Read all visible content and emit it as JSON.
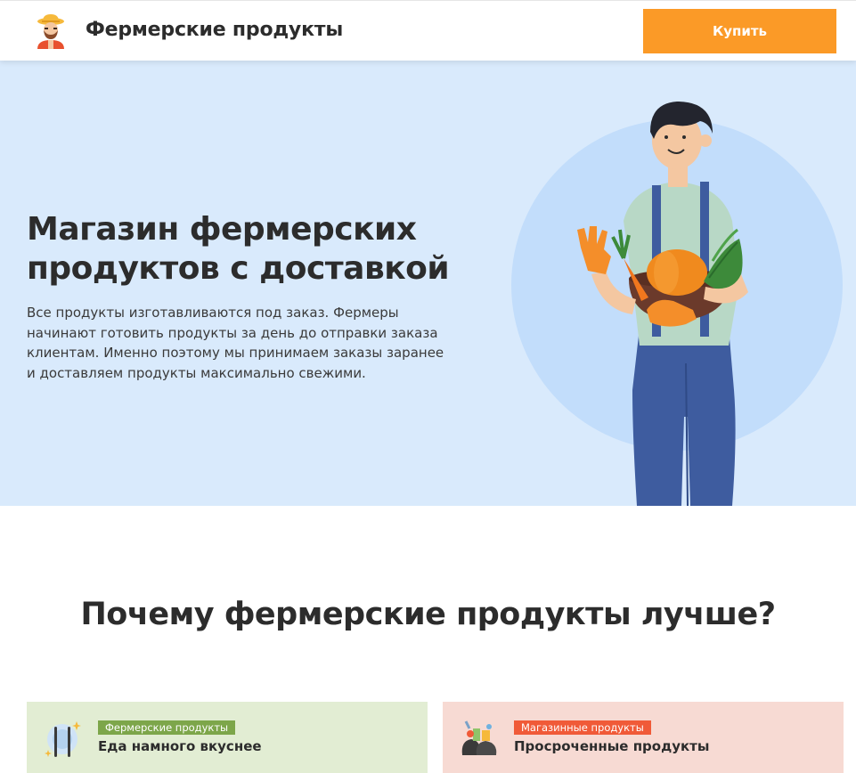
{
  "header": {
    "logo_icon": "farmer-avatar-icon",
    "title": "Фермерские продукты",
    "buy_label": "Купить"
  },
  "hero": {
    "title": "Магазин фермерских продуктов с доставкой",
    "text": "Все продукты изготавливаются под заказ. Фермеры начинают готовить продукты за день до отправки заказа клиентам. Именно поэтому мы принимаем заказы заранее и доставляем продукты максимально свежими.",
    "illustration": "farmer-with-vegetable-basket-illustration"
  },
  "why": {
    "title": "Почему фермерские продукты лучше?"
  },
  "cards": [
    {
      "icon": "plate-cutlery-icon",
      "badge": "Фермерские продукты",
      "title": "Еда намного вкуснее"
    },
    {
      "icon": "garbage-bags-icon",
      "badge": "Магазинные продукты",
      "title": "Просроченные продукты"
    }
  ],
  "colors": {
    "accent": "#fb9a27",
    "hero_bg": "#d9eafc",
    "farm_card_bg": "#e2edd3",
    "farm_badge": "#7da64a",
    "store_card_bg": "#f7dad3",
    "store_badge": "#f05a38"
  }
}
